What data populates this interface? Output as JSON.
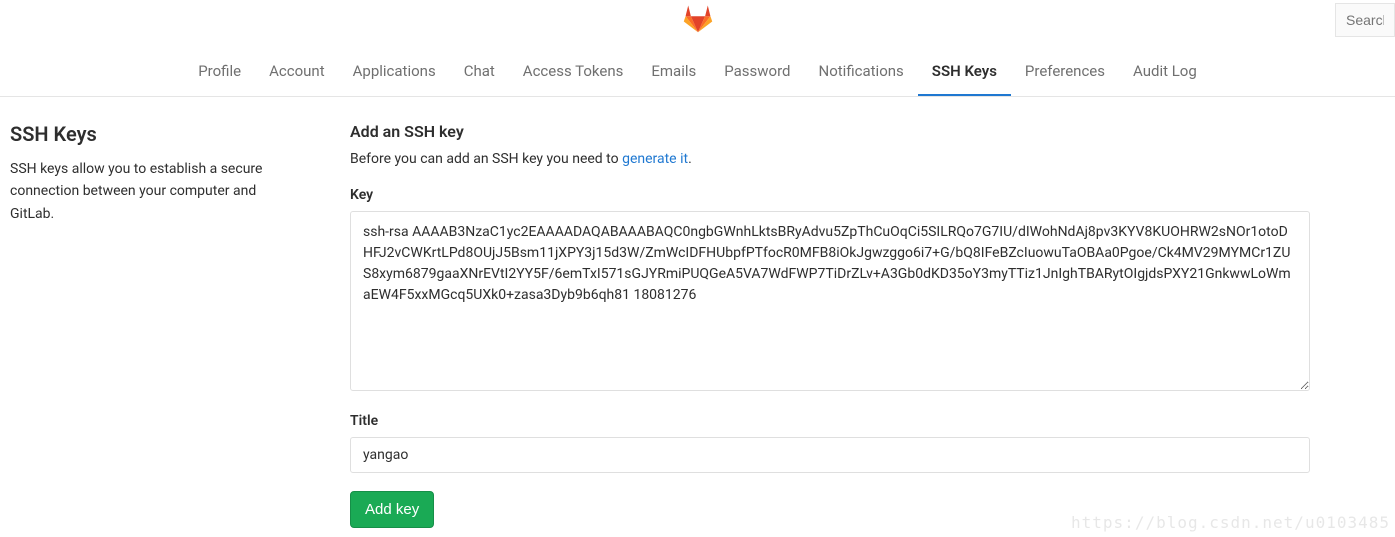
{
  "search": {
    "placeholder": "Search"
  },
  "nav": {
    "tabs": [
      {
        "label": "Profile",
        "active": false
      },
      {
        "label": "Account",
        "active": false
      },
      {
        "label": "Applications",
        "active": false
      },
      {
        "label": "Chat",
        "active": false
      },
      {
        "label": "Access Tokens",
        "active": false
      },
      {
        "label": "Emails",
        "active": false
      },
      {
        "label": "Password",
        "active": false
      },
      {
        "label": "Notifications",
        "active": false
      },
      {
        "label": "SSH Keys",
        "active": true
      },
      {
        "label": "Preferences",
        "active": false
      },
      {
        "label": "Audit Log",
        "active": false
      }
    ]
  },
  "sidebar": {
    "title": "SSH Keys",
    "description": "SSH keys allow you to establish a secure connection between your computer and GitLab."
  },
  "form": {
    "title": "Add an SSH key",
    "info_prefix": "Before you can add an SSH key you need to ",
    "info_link": "generate it",
    "info_suffix": ".",
    "key_label": "Key",
    "key_value": "ssh-rsa AAAAB3NzaC1yc2EAAAADAQABAAABAQC0ngbGWnhLktsBRyAdvu5ZpThCuOqCi5SILRQo7G7IU/dIWohNdAj8pv3KYV8KUOHRW2sNOr1otoDHFJ2vCWKrtLPd8OUjJ5Bsm11jXPY3j15d3W/ZmWcIDFHUbpfPTfocR0MFB8iOkJgwzggo6i7+G/bQ8IFeBZcIuowuTaOBAa0Pgoe/Ck4MV29MYMCr1ZUS8xym6879gaaXNrEVtI2YY5F/6emTxI571sGJYRmiPUQGeA5VA7WdFWP7TiDrZLv+A3Gb0dKD35oY3myTTiz1JnIghTBARytOIgjdsPXY21GnkwwLoWmaEW4F5xxMGcq5UXk0+zasa3Dyb9b6qh81 18081276",
    "title_label": "Title",
    "title_value": "yangao",
    "submit_label": "Add key"
  },
  "watermark": "https://blog.csdn.net/u0103485"
}
